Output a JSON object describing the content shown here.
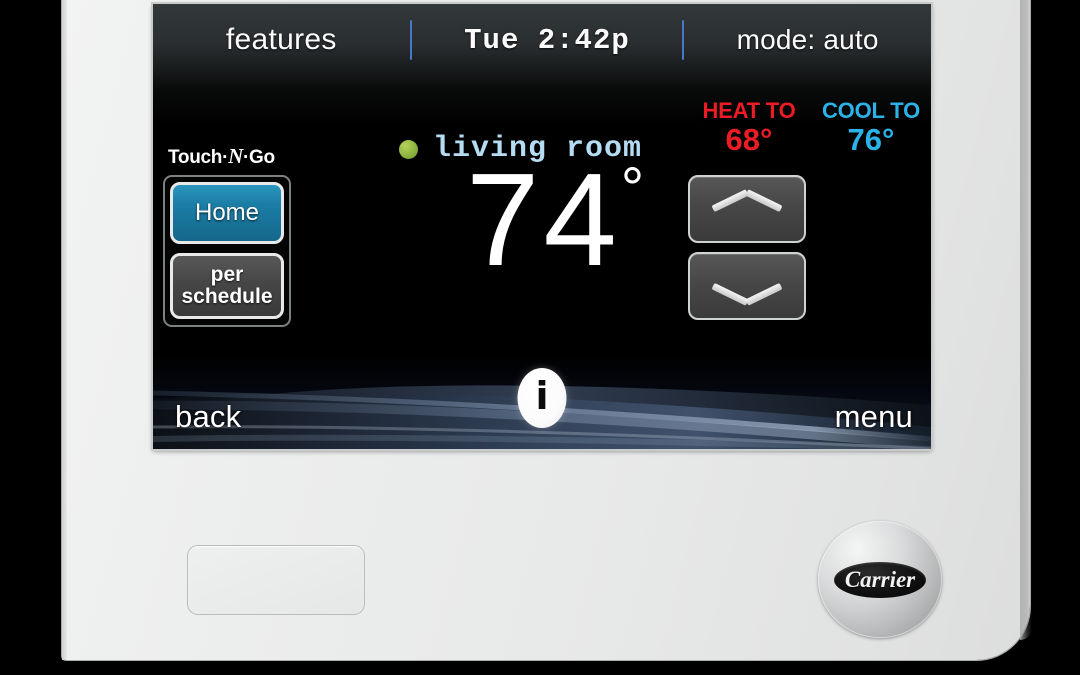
{
  "device": {
    "brand": "Carrier",
    "badge_name": "carrier-logo-badge"
  },
  "screen": {
    "header": {
      "features_label": "features",
      "time": "Tue  2:42p",
      "mode": "mode: auto",
      "divider_color": "#4a76c8"
    },
    "touch_n_go": {
      "logo_prefix": "Touch·",
      "logo_n": "N",
      "logo_suffix": "·Go",
      "buttons": [
        {
          "label": "Home",
          "state": "selected",
          "color": "#1b7da5"
        },
        {
          "label": "per schedule",
          "state": "normal",
          "color": "#464646"
        }
      ]
    },
    "zone": {
      "indicator": "status-dot-green",
      "indicator_color": "#8cb43f",
      "name": "living room",
      "name_color": "#b5dcf2"
    },
    "current_temperature": {
      "value": "74",
      "degree_symbol": "°"
    },
    "setpoints": [
      {
        "label": "HEAT TO",
        "value": "68°",
        "color": "#ec1c24",
        "key": "heat"
      },
      {
        "label": "COOL TO",
        "value": "76°",
        "color": "#2bb3e8",
        "key": "cool"
      }
    ],
    "arrows": {
      "up_name": "temperature-up-button",
      "down_name": "temperature-down-button"
    },
    "footer": {
      "back_label": "back",
      "info_label": "i",
      "menu_label": "menu"
    }
  }
}
